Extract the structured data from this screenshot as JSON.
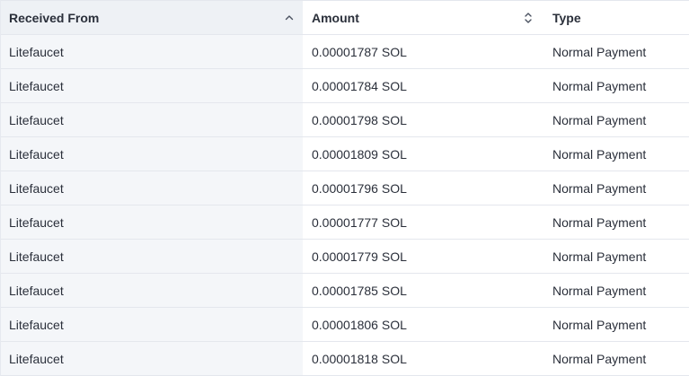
{
  "columns": {
    "received_from": "Received From",
    "amount": "Amount",
    "type": "Type"
  },
  "icons": {
    "received_from_sort": "chevron-up-icon",
    "amount_sort": "sort-up-down-icon"
  },
  "rows": [
    {
      "from": "Litefaucet",
      "amount": "0.00001787 SOL",
      "type": "Normal Payment"
    },
    {
      "from": "Litefaucet",
      "amount": "0.00001784 SOL",
      "type": "Normal Payment"
    },
    {
      "from": "Litefaucet",
      "amount": "0.00001798 SOL",
      "type": "Normal Payment"
    },
    {
      "from": "Litefaucet",
      "amount": "0.00001809 SOL",
      "type": "Normal Payment"
    },
    {
      "from": "Litefaucet",
      "amount": "0.00001796 SOL",
      "type": "Normal Payment"
    },
    {
      "from": "Litefaucet",
      "amount": "0.00001777 SOL",
      "type": "Normal Payment"
    },
    {
      "from": "Litefaucet",
      "amount": "0.00001779 SOL",
      "type": "Normal Payment"
    },
    {
      "from": "Litefaucet",
      "amount": "0.00001785 SOL",
      "type": "Normal Payment"
    },
    {
      "from": "Litefaucet",
      "amount": "0.00001806 SOL",
      "type": "Normal Payment"
    },
    {
      "from": "Litefaucet",
      "amount": "0.00001818 SOL",
      "type": "Normal Payment"
    }
  ]
}
